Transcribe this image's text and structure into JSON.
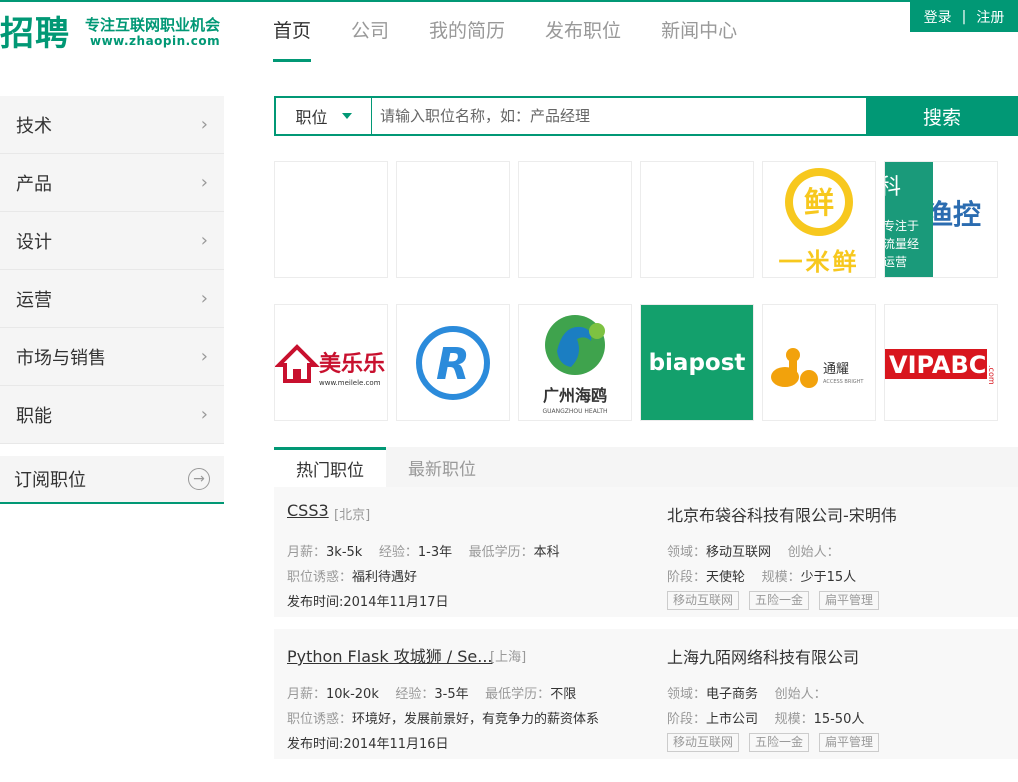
{
  "header": {
    "logo_main": "招聘",
    "logo_slogan": "专注互联网职业机会",
    "logo_url": "www.zhaopin.com",
    "nav": [
      "首页",
      "公司",
      "我的简历",
      "发布职位",
      "新闻中心"
    ],
    "login": "登录",
    "separator": "|",
    "register": "注册"
  },
  "sidebar": {
    "items": [
      "技术",
      "产品",
      "设计",
      "运营",
      "市场与销售",
      "职能"
    ],
    "subscribe": "订阅职位"
  },
  "search": {
    "type": "职位",
    "placeholder": "请输入职位名称，如：产品经理",
    "button": "搜索"
  },
  "logos": {
    "yimixian": "一米鲜",
    "yimixian_char": "鲜",
    "banner_word1": "科",
    "banner_word2": "渔控",
    "banner_line1": "专注于",
    "banner_line2": "流量经",
    "banner_line3": "运营",
    "meilele": "美乐乐",
    "meilele_url": "www.meilele.com",
    "pr_letter": "R",
    "haiou": "广州海鸥",
    "haiou_en": "GUANGZHOU HEALTH",
    "biapost": "biapost",
    "tongyao": "通耀",
    "tongyao_en": "ACCESS BRIGHT",
    "vipabc": "VIPABC",
    "vipabc_com": ".com"
  },
  "tabs": [
    "热门职位",
    "最新职位"
  ],
  "jobs": [
    {
      "title": "CSS3",
      "city": "[北京]",
      "salary_k": "月薪：",
      "salary": "3k-5k",
      "exp_k": "经验：",
      "exp": "1-3年",
      "edu_k": "最低学历：",
      "edu": "本科",
      "perk_k": "职位诱惑：",
      "perk": "福利待遇好",
      "date": "发布时间:2014年11月17日",
      "company": "北京布袋谷科技有限公司-宋明伟",
      "field_k": "领域：",
      "field": "移动互联网",
      "founder_k": "创始人：",
      "stage_k": "阶段：",
      "stage": "天使轮",
      "scale_k": "规模：",
      "scale": "少于15人",
      "tags": [
        "移动互联网",
        "五险一金",
        "扁平管理"
      ]
    },
    {
      "title": "Python Flask 攻城狮 / Se...",
      "city": "[上海]",
      "salary_k": "月薪：",
      "salary": "10k-20k",
      "exp_k": "经验：",
      "exp": "3-5年",
      "edu_k": "最低学历：",
      "edu": "不限",
      "perk_k": "职位诱惑：",
      "perk": "环境好，发展前景好，有竞争力的薪资体系",
      "date": "发布时间:2014年11月16日",
      "company": "上海九陌网络科技有限公司",
      "field_k": "领域：",
      "field": "电子商务",
      "founder_k": "创始人：",
      "stage_k": "阶段：",
      "stage": "上市公司",
      "scale_k": "规模：",
      "scale": "15-50人",
      "tags": [
        "移动互联网",
        "五险一金",
        "扁平管理"
      ]
    }
  ],
  "colors": {
    "accent": "#019875",
    "muted": "#999999",
    "panel": "#f5f5f5"
  }
}
